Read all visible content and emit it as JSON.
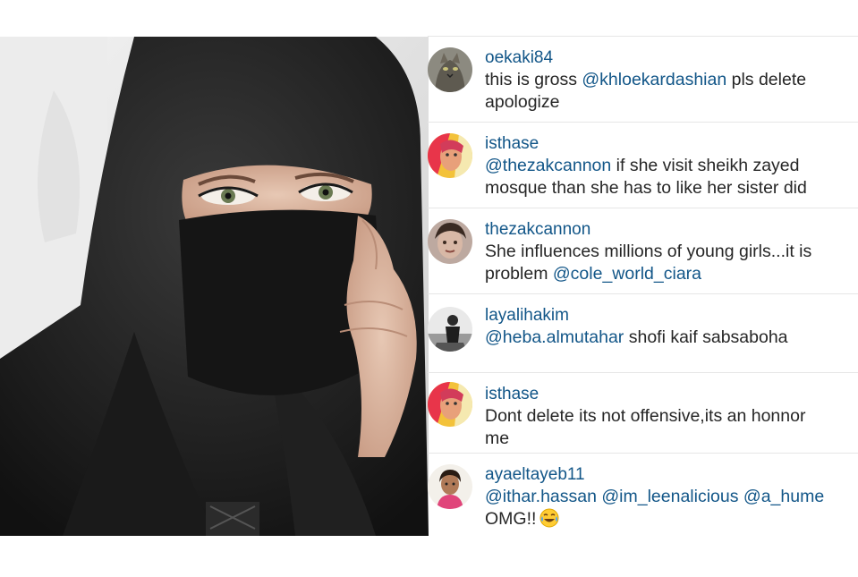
{
  "comments": [
    {
      "username": "oekaki84",
      "avatar_icon": "cat-photo-avatar",
      "lines": [
        [
          {
            "t": "text",
            "v": "this is gross "
          },
          {
            "t": "mention",
            "v": "@khloekardashian"
          },
          {
            "t": "text",
            "v": "  pls delete"
          }
        ],
        [
          {
            "t": "text",
            "v": "apologize"
          }
        ]
      ]
    },
    {
      "username": "isthase",
      "avatar_icon": "colorful-portrait-avatar",
      "lines": [
        [
          {
            "t": "mention",
            "v": "@thezakcannon"
          },
          {
            "t": "text",
            "v": " if she visit sheikh zayed"
          }
        ],
        [
          {
            "t": "text",
            "v": "mosque than she has to like her sister did"
          }
        ]
      ]
    },
    {
      "username": "thezakcannon",
      "avatar_icon": "portrait-avatar",
      "lines": [
        [
          {
            "t": "text",
            "v": "She influences millions of young girls...it is"
          }
        ],
        [
          {
            "t": "text",
            "v": "problem "
          },
          {
            "t": "mention",
            "v": "@cole_world_ciara"
          }
        ]
      ]
    },
    {
      "username": "layalihakim",
      "avatar_icon": "black-white-photo-avatar",
      "lines": [
        [
          {
            "t": "mention",
            "v": "@heba.almutahar"
          },
          {
            "t": "text",
            "v": "  shofi kaif sabsaboha"
          }
        ]
      ]
    },
    {
      "username": "isthase",
      "avatar_icon": "colorful-portrait-avatar",
      "lines": [
        [
          {
            "t": "text",
            "v": "Dont delete its not offensive,its an honnor"
          }
        ],
        [
          {
            "t": "text",
            "v": "me"
          }
        ]
      ]
    },
    {
      "username": "ayaeltayeb11",
      "avatar_icon": "woman-portrait-avatar",
      "lines": [
        [
          {
            "t": "mention",
            "v": "@ithar.hassan"
          },
          {
            "t": "text",
            "v": " "
          },
          {
            "t": "mention",
            "v": "@im_leenalicious"
          },
          {
            "t": "text",
            "v": " "
          },
          {
            "t": "mention",
            "v": "@a_hume"
          }
        ],
        [
          {
            "t": "text",
            "v": "OMG!!"
          },
          {
            "t": "emoji",
            "v": "tears-of-joy-emoji"
          }
        ]
      ]
    }
  ],
  "colors": {
    "username": "#125688",
    "mention": "#125688",
    "text": "#262626",
    "divider": "#e6e6e6"
  }
}
